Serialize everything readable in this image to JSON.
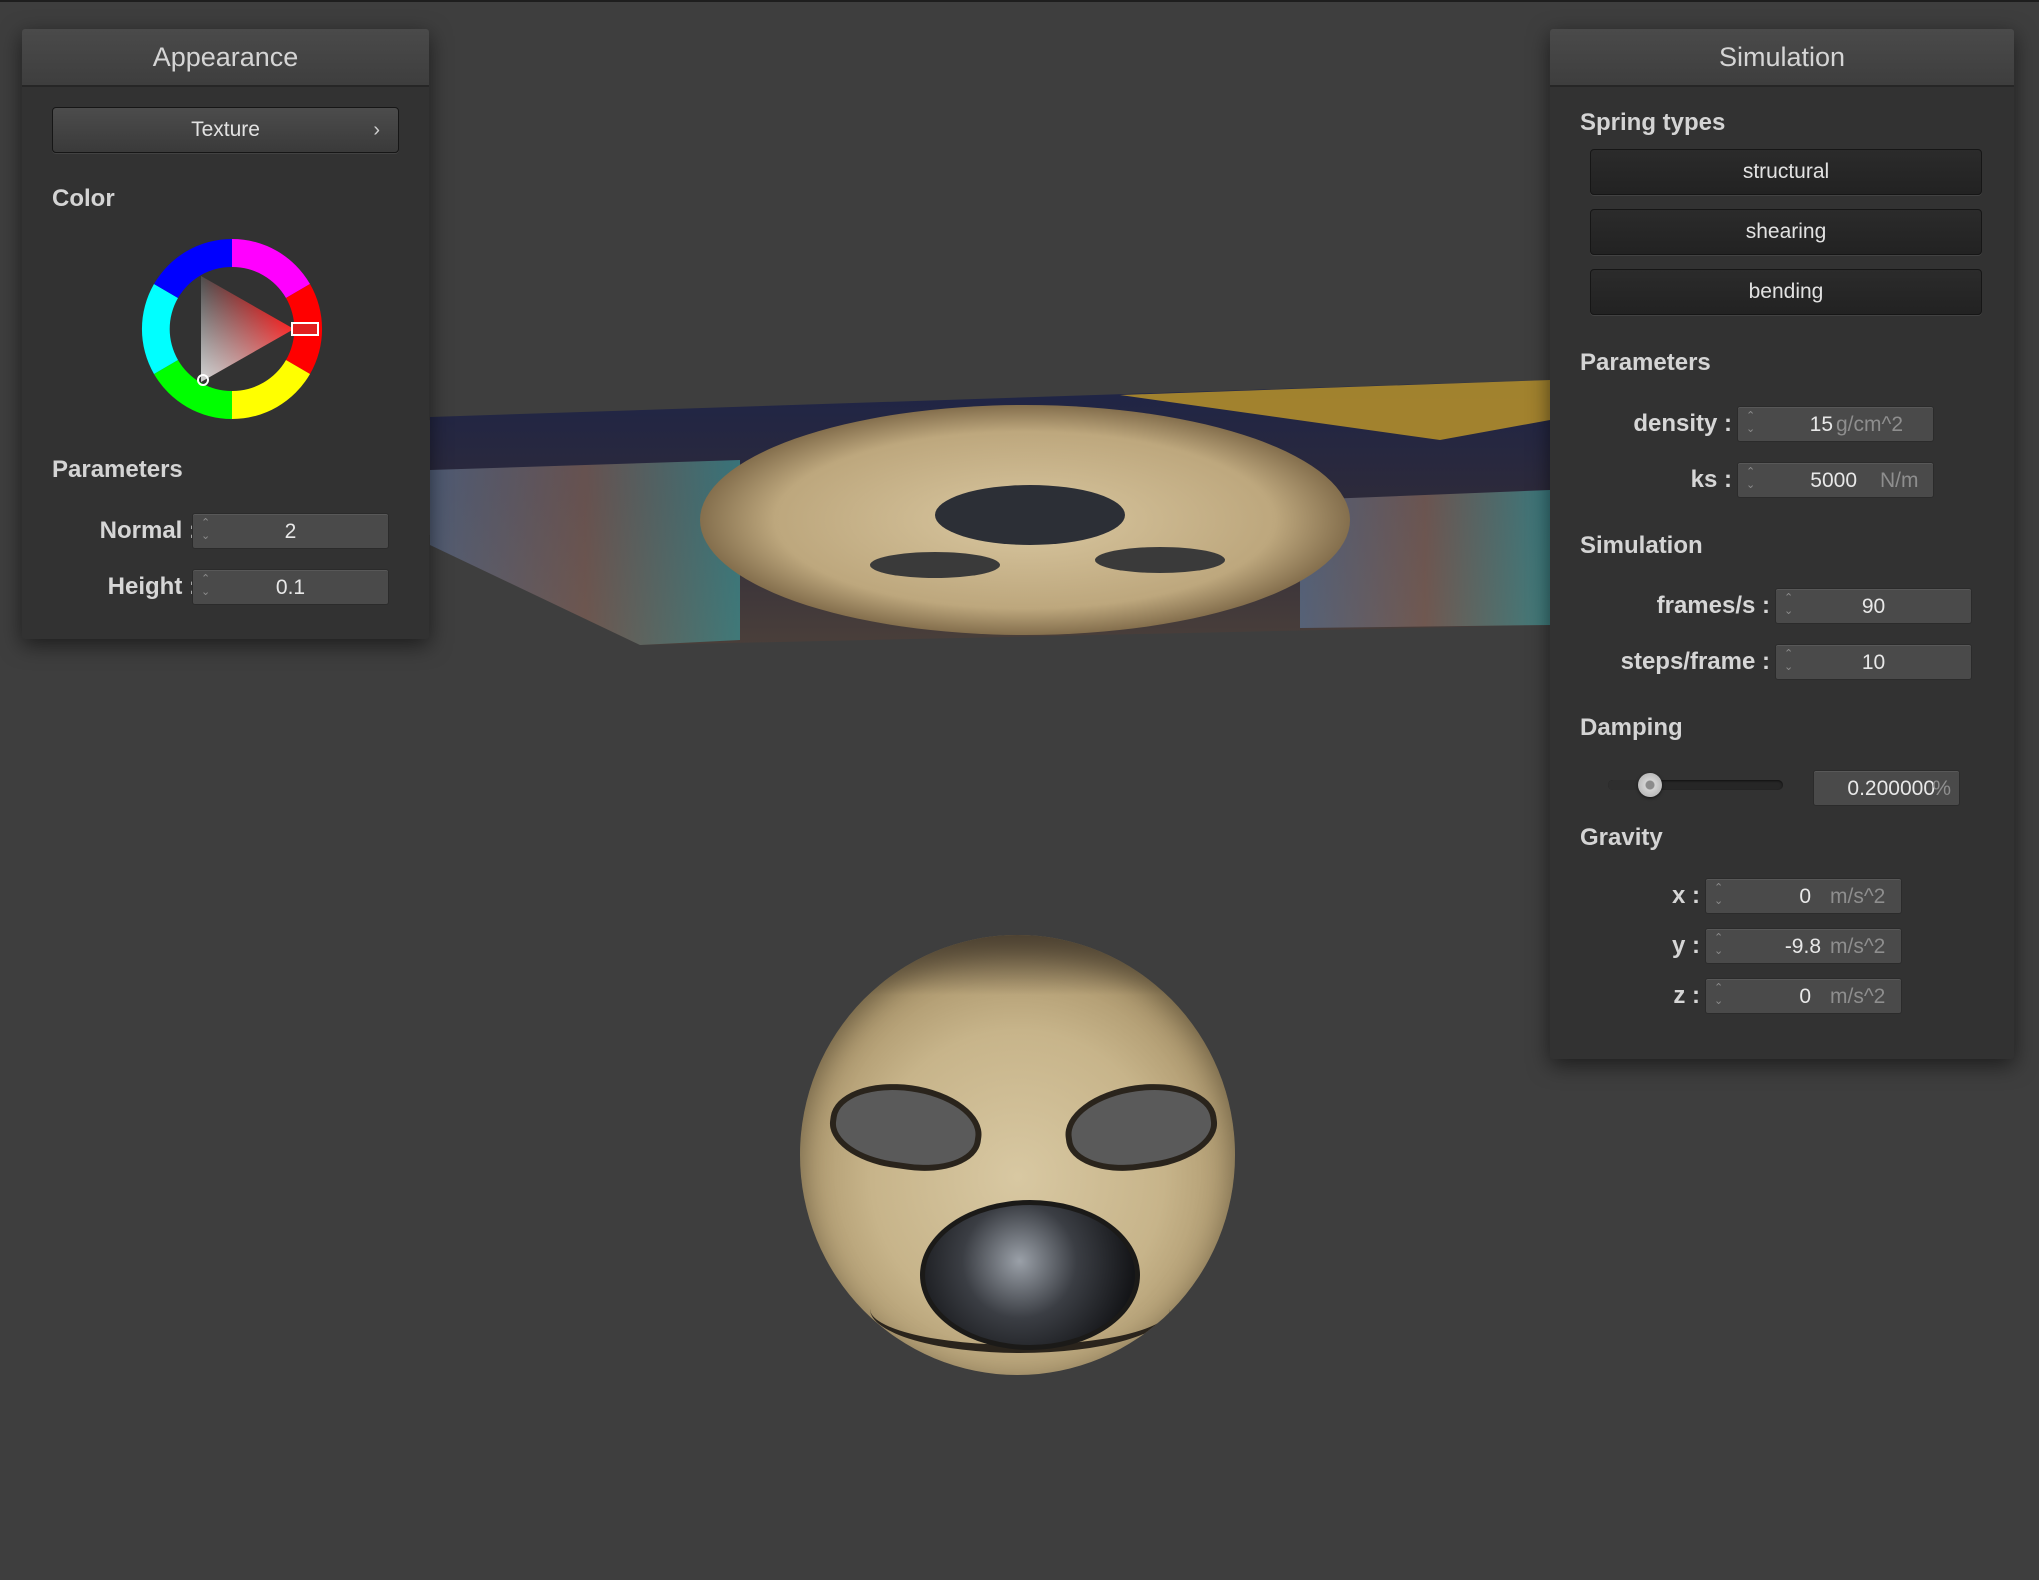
{
  "appearance": {
    "title": "Appearance",
    "texture_button": "Texture",
    "texture_chevron": "›",
    "color_label": "Color",
    "color_value": "#ff0000",
    "parameters_label": "Parameters",
    "normal": {
      "label": "Normal :",
      "value": "2"
    },
    "height": {
      "label": "Height :",
      "value": "0.1"
    }
  },
  "simulation": {
    "title": "Simulation",
    "spring_types_label": "Spring types",
    "spring_buttons": [
      "structural",
      "shearing",
      "bending"
    ],
    "parameters_label": "Parameters",
    "density": {
      "label": "density :",
      "value": "15",
      "unit": "g/cm^2"
    },
    "ks": {
      "label": "ks :",
      "value": "5000",
      "unit": "N/m"
    },
    "simulation_label": "Simulation",
    "frames": {
      "label": "frames/s :",
      "value": "90"
    },
    "steps": {
      "label": "steps/frame :",
      "value": "10"
    },
    "damping_label": "Damping",
    "damping": {
      "value": "0.200000",
      "unit": "%",
      "slider_fraction": 0.2
    },
    "gravity_label": "Gravity",
    "gravity": [
      {
        "label": "x :",
        "value": "0",
        "unit": "m/s^2"
      },
      {
        "label": "y :",
        "value": "-9.8",
        "unit": "m/s^2"
      },
      {
        "label": "z :",
        "value": "0",
        "unit": "m/s^2"
      }
    ]
  },
  "scene": {
    "cloth": "textured-cloth",
    "sphere": "textured-sphere"
  }
}
